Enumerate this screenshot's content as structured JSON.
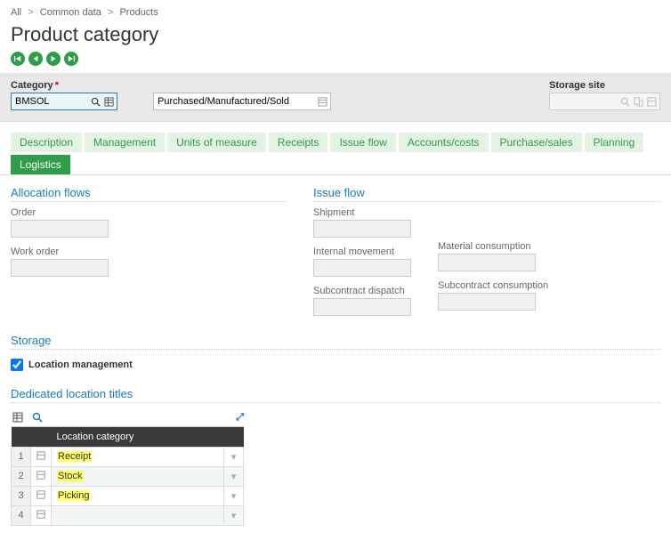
{
  "breadcrumb": {
    "b0": "All",
    "b1": "Common data",
    "b2": "Products"
  },
  "page": {
    "title": "Product category"
  },
  "filters": {
    "category": {
      "label": "Category",
      "value": "BMSOL"
    },
    "desc": {
      "value": "Purchased/Manufactured/Sold"
    },
    "site": {
      "label": "Storage site",
      "value": ""
    }
  },
  "tabs": {
    "t0": "Description",
    "t1": "Management",
    "t2": "Units of measure",
    "t3": "Receipts",
    "t4": "Issue flow",
    "t5": "Accounts/costs",
    "t6": "Purchase/sales",
    "t7": "Planning",
    "t8": "Logistics"
  },
  "sections": {
    "allocation": "Allocation flows",
    "issue": "Issue flow",
    "storage": "Storage",
    "dedicated": "Dedicated location titles"
  },
  "fields": {
    "order": "Order",
    "workorder": "Work order",
    "shipment": "Shipment",
    "internal": "Internal movement",
    "subdispatch": "Subcontract dispatch",
    "matcons": "Material consumption",
    "subcons": "Subcontract consumption"
  },
  "storage": {
    "locmgmt": "Location management",
    "checked": true
  },
  "grid": {
    "header": "Location category",
    "rows": [
      {
        "n": "1",
        "cat": "Receipt"
      },
      {
        "n": "2",
        "cat": "Stock"
      },
      {
        "n": "3",
        "cat": "Picking"
      },
      {
        "n": "4",
        "cat": ""
      }
    ]
  }
}
